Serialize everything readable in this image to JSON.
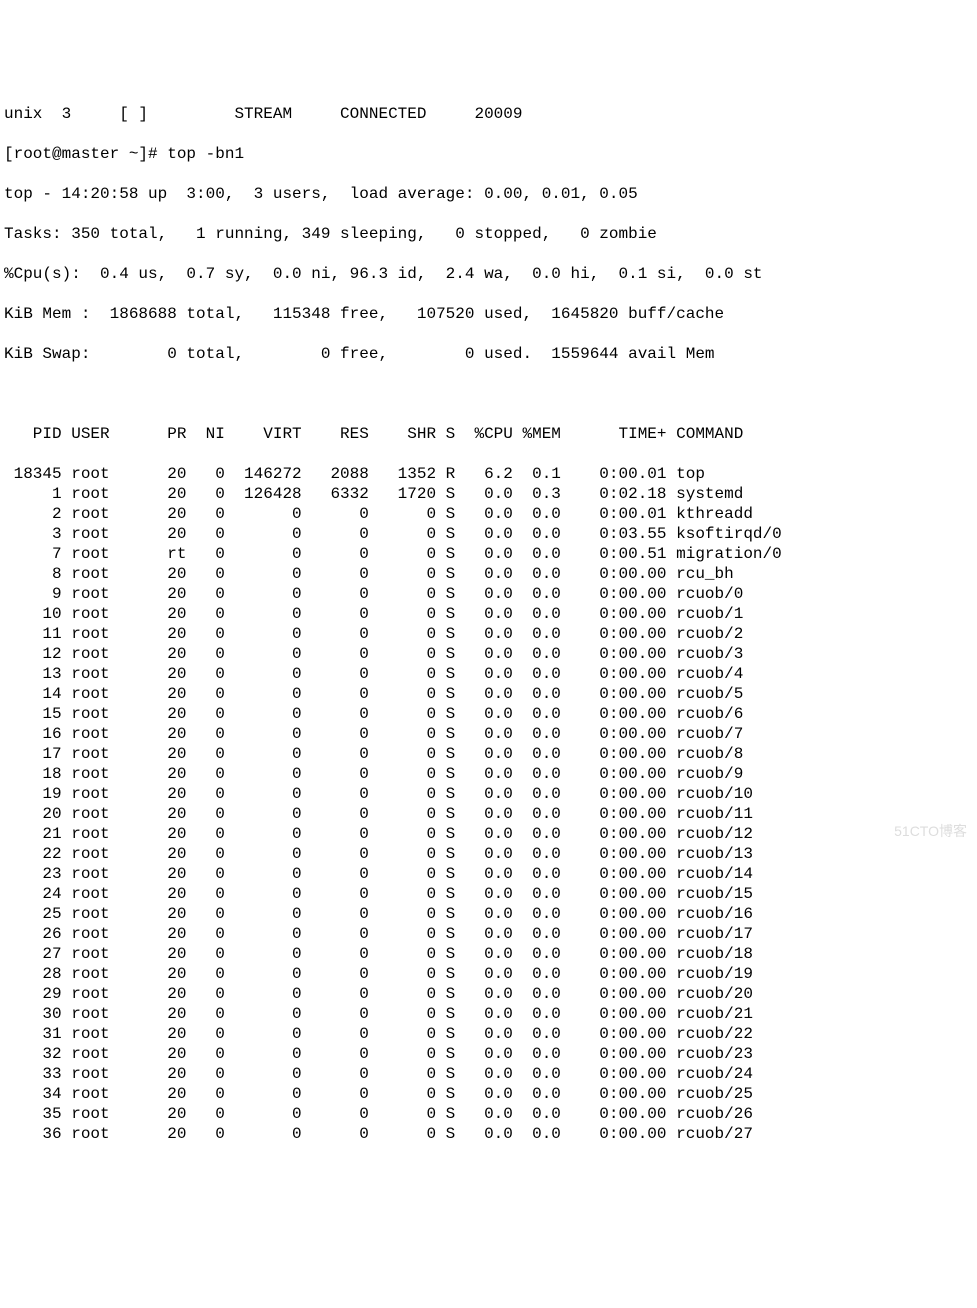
{
  "preline": "unix  3     [ ]         STREAM     CONNECTED     20009",
  "prompt": "[root@master ~]# top -bn1",
  "summary": {
    "line1": "top - 14:20:58 up  3:00,  3 users,  load average: 0.00, 0.01, 0.05",
    "tasks": "Tasks: 350 total,   1 running, 349 sleeping,   0 stopped,   0 zombie",
    "cpu": "%Cpu(s):  0.4 us,  0.7 sy,  0.0 ni, 96.3 id,  2.4 wa,  0.0 hi,  0.1 si,  0.0 st",
    "mem": "KiB Mem :  1868688 total,   115348 free,   107520 used,  1645820 buff/cache",
    "swap": "KiB Swap:        0 total,        0 free,        0 used.  1559644 avail Mem"
  },
  "columns": [
    "PID",
    "USER",
    "PR",
    "NI",
    "VIRT",
    "RES",
    "SHR",
    "S",
    "%CPU",
    "%MEM",
    "TIME+",
    "COMMAND"
  ],
  "rows": [
    {
      "pid": "18345",
      "user": "root",
      "pr": "20",
      "ni": "0",
      "virt": "146272",
      "res": "2088",
      "shr": "1352",
      "s": "R",
      "cpu": "6.2",
      "mem": "0.1",
      "time": "0:00.01",
      "cmd": "top"
    },
    {
      "pid": "1",
      "user": "root",
      "pr": "20",
      "ni": "0",
      "virt": "126428",
      "res": "6332",
      "shr": "1720",
      "s": "S",
      "cpu": "0.0",
      "mem": "0.3",
      "time": "0:02.18",
      "cmd": "systemd"
    },
    {
      "pid": "2",
      "user": "root",
      "pr": "20",
      "ni": "0",
      "virt": "0",
      "res": "0",
      "shr": "0",
      "s": "S",
      "cpu": "0.0",
      "mem": "0.0",
      "time": "0:00.01",
      "cmd": "kthreadd"
    },
    {
      "pid": "3",
      "user": "root",
      "pr": "20",
      "ni": "0",
      "virt": "0",
      "res": "0",
      "shr": "0",
      "s": "S",
      "cpu": "0.0",
      "mem": "0.0",
      "time": "0:03.55",
      "cmd": "ksoftirqd/0"
    },
    {
      "pid": "7",
      "user": "root",
      "pr": "rt",
      "ni": "0",
      "virt": "0",
      "res": "0",
      "shr": "0",
      "s": "S",
      "cpu": "0.0",
      "mem": "0.0",
      "time": "0:00.51",
      "cmd": "migration/0"
    },
    {
      "pid": "8",
      "user": "root",
      "pr": "20",
      "ni": "0",
      "virt": "0",
      "res": "0",
      "shr": "0",
      "s": "S",
      "cpu": "0.0",
      "mem": "0.0",
      "time": "0:00.00",
      "cmd": "rcu_bh"
    },
    {
      "pid": "9",
      "user": "root",
      "pr": "20",
      "ni": "0",
      "virt": "0",
      "res": "0",
      "shr": "0",
      "s": "S",
      "cpu": "0.0",
      "mem": "0.0",
      "time": "0:00.00",
      "cmd": "rcuob/0"
    },
    {
      "pid": "10",
      "user": "root",
      "pr": "20",
      "ni": "0",
      "virt": "0",
      "res": "0",
      "shr": "0",
      "s": "S",
      "cpu": "0.0",
      "mem": "0.0",
      "time": "0:00.00",
      "cmd": "rcuob/1"
    },
    {
      "pid": "11",
      "user": "root",
      "pr": "20",
      "ni": "0",
      "virt": "0",
      "res": "0",
      "shr": "0",
      "s": "S",
      "cpu": "0.0",
      "mem": "0.0",
      "time": "0:00.00",
      "cmd": "rcuob/2"
    },
    {
      "pid": "12",
      "user": "root",
      "pr": "20",
      "ni": "0",
      "virt": "0",
      "res": "0",
      "shr": "0",
      "s": "S",
      "cpu": "0.0",
      "mem": "0.0",
      "time": "0:00.00",
      "cmd": "rcuob/3"
    },
    {
      "pid": "13",
      "user": "root",
      "pr": "20",
      "ni": "0",
      "virt": "0",
      "res": "0",
      "shr": "0",
      "s": "S",
      "cpu": "0.0",
      "mem": "0.0",
      "time": "0:00.00",
      "cmd": "rcuob/4"
    },
    {
      "pid": "14",
      "user": "root",
      "pr": "20",
      "ni": "0",
      "virt": "0",
      "res": "0",
      "shr": "0",
      "s": "S",
      "cpu": "0.0",
      "mem": "0.0",
      "time": "0:00.00",
      "cmd": "rcuob/5"
    },
    {
      "pid": "15",
      "user": "root",
      "pr": "20",
      "ni": "0",
      "virt": "0",
      "res": "0",
      "shr": "0",
      "s": "S",
      "cpu": "0.0",
      "mem": "0.0",
      "time": "0:00.00",
      "cmd": "rcuob/6"
    },
    {
      "pid": "16",
      "user": "root",
      "pr": "20",
      "ni": "0",
      "virt": "0",
      "res": "0",
      "shr": "0",
      "s": "S",
      "cpu": "0.0",
      "mem": "0.0",
      "time": "0:00.00",
      "cmd": "rcuob/7"
    },
    {
      "pid": "17",
      "user": "root",
      "pr": "20",
      "ni": "0",
      "virt": "0",
      "res": "0",
      "shr": "0",
      "s": "S",
      "cpu": "0.0",
      "mem": "0.0",
      "time": "0:00.00",
      "cmd": "rcuob/8"
    },
    {
      "pid": "18",
      "user": "root",
      "pr": "20",
      "ni": "0",
      "virt": "0",
      "res": "0",
      "shr": "0",
      "s": "S",
      "cpu": "0.0",
      "mem": "0.0",
      "time": "0:00.00",
      "cmd": "rcuob/9"
    },
    {
      "pid": "19",
      "user": "root",
      "pr": "20",
      "ni": "0",
      "virt": "0",
      "res": "0",
      "shr": "0",
      "s": "S",
      "cpu": "0.0",
      "mem": "0.0",
      "time": "0:00.00",
      "cmd": "rcuob/10"
    },
    {
      "pid": "20",
      "user": "root",
      "pr": "20",
      "ni": "0",
      "virt": "0",
      "res": "0",
      "shr": "0",
      "s": "S",
      "cpu": "0.0",
      "mem": "0.0",
      "time": "0:00.00",
      "cmd": "rcuob/11"
    },
    {
      "pid": "21",
      "user": "root",
      "pr": "20",
      "ni": "0",
      "virt": "0",
      "res": "0",
      "shr": "0",
      "s": "S",
      "cpu": "0.0",
      "mem": "0.0",
      "time": "0:00.00",
      "cmd": "rcuob/12"
    },
    {
      "pid": "22",
      "user": "root",
      "pr": "20",
      "ni": "0",
      "virt": "0",
      "res": "0",
      "shr": "0",
      "s": "S",
      "cpu": "0.0",
      "mem": "0.0",
      "time": "0:00.00",
      "cmd": "rcuob/13"
    },
    {
      "pid": "23",
      "user": "root",
      "pr": "20",
      "ni": "0",
      "virt": "0",
      "res": "0",
      "shr": "0",
      "s": "S",
      "cpu": "0.0",
      "mem": "0.0",
      "time": "0:00.00",
      "cmd": "rcuob/14"
    },
    {
      "pid": "24",
      "user": "root",
      "pr": "20",
      "ni": "0",
      "virt": "0",
      "res": "0",
      "shr": "0",
      "s": "S",
      "cpu": "0.0",
      "mem": "0.0",
      "time": "0:00.00",
      "cmd": "rcuob/15"
    },
    {
      "pid": "25",
      "user": "root",
      "pr": "20",
      "ni": "0",
      "virt": "0",
      "res": "0",
      "shr": "0",
      "s": "S",
      "cpu": "0.0",
      "mem": "0.0",
      "time": "0:00.00",
      "cmd": "rcuob/16"
    },
    {
      "pid": "26",
      "user": "root",
      "pr": "20",
      "ni": "0",
      "virt": "0",
      "res": "0",
      "shr": "0",
      "s": "S",
      "cpu": "0.0",
      "mem": "0.0",
      "time": "0:00.00",
      "cmd": "rcuob/17"
    },
    {
      "pid": "27",
      "user": "root",
      "pr": "20",
      "ni": "0",
      "virt": "0",
      "res": "0",
      "shr": "0",
      "s": "S",
      "cpu": "0.0",
      "mem": "0.0",
      "time": "0:00.00",
      "cmd": "rcuob/18"
    },
    {
      "pid": "28",
      "user": "root",
      "pr": "20",
      "ni": "0",
      "virt": "0",
      "res": "0",
      "shr": "0",
      "s": "S",
      "cpu": "0.0",
      "mem": "0.0",
      "time": "0:00.00",
      "cmd": "rcuob/19"
    },
    {
      "pid": "29",
      "user": "root",
      "pr": "20",
      "ni": "0",
      "virt": "0",
      "res": "0",
      "shr": "0",
      "s": "S",
      "cpu": "0.0",
      "mem": "0.0",
      "time": "0:00.00",
      "cmd": "rcuob/20"
    },
    {
      "pid": "30",
      "user": "root",
      "pr": "20",
      "ni": "0",
      "virt": "0",
      "res": "0",
      "shr": "0",
      "s": "S",
      "cpu": "0.0",
      "mem": "0.0",
      "time": "0:00.00",
      "cmd": "rcuob/21"
    },
    {
      "pid": "31",
      "user": "root",
      "pr": "20",
      "ni": "0",
      "virt": "0",
      "res": "0",
      "shr": "0",
      "s": "S",
      "cpu": "0.0",
      "mem": "0.0",
      "time": "0:00.00",
      "cmd": "rcuob/22"
    },
    {
      "pid": "32",
      "user": "root",
      "pr": "20",
      "ni": "0",
      "virt": "0",
      "res": "0",
      "shr": "0",
      "s": "S",
      "cpu": "0.0",
      "mem": "0.0",
      "time": "0:00.00",
      "cmd": "rcuob/23"
    },
    {
      "pid": "33",
      "user": "root",
      "pr": "20",
      "ni": "0",
      "virt": "0",
      "res": "0",
      "shr": "0",
      "s": "S",
      "cpu": "0.0",
      "mem": "0.0",
      "time": "0:00.00",
      "cmd": "rcuob/24"
    },
    {
      "pid": "34",
      "user": "root",
      "pr": "20",
      "ni": "0",
      "virt": "0",
      "res": "0",
      "shr": "0",
      "s": "S",
      "cpu": "0.0",
      "mem": "0.0",
      "time": "0:00.00",
      "cmd": "rcuob/25"
    },
    {
      "pid": "35",
      "user": "root",
      "pr": "20",
      "ni": "0",
      "virt": "0",
      "res": "0",
      "shr": "0",
      "s": "S",
      "cpu": "0.0",
      "mem": "0.0",
      "time": "0:00.00",
      "cmd": "rcuob/26"
    },
    {
      "pid": "36",
      "user": "root",
      "pr": "20",
      "ni": "0",
      "virt": "0",
      "res": "0",
      "shr": "0",
      "s": "S",
      "cpu": "0.0",
      "mem": "0.0",
      "time": "0:00.00",
      "cmd": "rcuob/27"
    }
  ],
  "watermark": "51CTO博客"
}
